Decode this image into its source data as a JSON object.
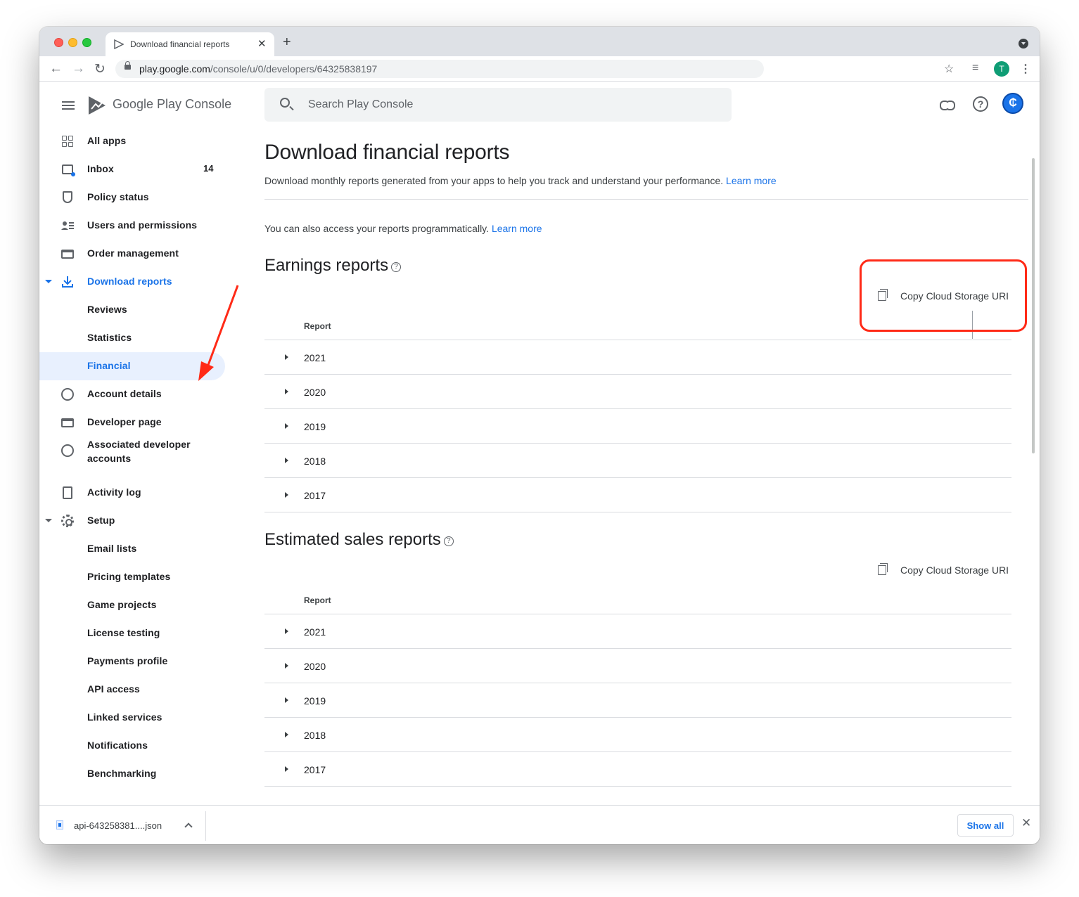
{
  "browser": {
    "tab_title": "Download financial reports",
    "tab_close": "✕",
    "new_tab": "+",
    "url_host": "play.google.com",
    "url_path": "/console/u/0/developers/64325838197",
    "profile_initial": "T"
  },
  "header": {
    "brand_google": "Google Play",
    "brand_console": "Console",
    "search_placeholder": "Search Play Console",
    "help_glyph": "?",
    "account_glyph": "₵"
  },
  "sidebar": {
    "items": [
      {
        "label": "All apps",
        "icon": "grid-icon"
      },
      {
        "label": "Inbox",
        "icon": "inbox-icon",
        "count": "14"
      },
      {
        "label": "Policy status",
        "icon": "shield-icon"
      },
      {
        "label": "Users and permissions",
        "icon": "users-icon"
      },
      {
        "label": "Order management",
        "icon": "credit-card-icon"
      },
      {
        "label": "Download reports",
        "icon": "download-icon"
      },
      {
        "label": "Reviews"
      },
      {
        "label": "Statistics"
      },
      {
        "label": "Financial"
      },
      {
        "label": "Account details",
        "icon": "account-circle-icon"
      },
      {
        "label": "Developer page",
        "icon": "web-page-icon"
      },
      {
        "label": "Associated developer accounts",
        "icon": "linked-accounts-icon"
      },
      {
        "label": "Activity log",
        "icon": "document-icon"
      },
      {
        "label": "Setup",
        "icon": "gear-icon"
      },
      {
        "label": "Email lists"
      },
      {
        "label": "Pricing templates"
      },
      {
        "label": "Game projects"
      },
      {
        "label": "License testing"
      },
      {
        "label": "Payments profile"
      },
      {
        "label": "API access"
      },
      {
        "label": "Linked services"
      },
      {
        "label": "Notifications"
      },
      {
        "label": "Benchmarking"
      }
    ]
  },
  "main": {
    "title": "Download financial reports",
    "description": "Download monthly reports generated from your apps to help you track and understand your performance.",
    "learn_more": "Learn more",
    "programmatic": "You can also access your reports programmatically.",
    "programmatic_learn_more": "Learn more",
    "sections": [
      {
        "title": "Earnings reports",
        "copy_label": "Copy Cloud Storage URI",
        "column_header": "Report",
        "rows": [
          "2021",
          "2020",
          "2019",
          "2018",
          "2017"
        ]
      },
      {
        "title": "Estimated sales reports",
        "copy_label": "Copy Cloud Storage URI",
        "column_header": "Report",
        "rows": [
          "2021",
          "2020",
          "2019",
          "2018",
          "2017"
        ]
      }
    ]
  },
  "download_bar": {
    "file_name": "api-643258381....json",
    "show_all": "Show all",
    "close": "✕"
  },
  "colors": {
    "accent": "#1a73e8",
    "annotation": "#ff2a17",
    "selected_bg": "#e8f0fe"
  }
}
